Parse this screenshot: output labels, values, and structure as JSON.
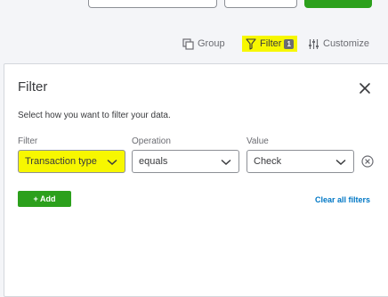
{
  "toolbar": {
    "group_label": "Group",
    "filter_label": "Filter",
    "filter_count": "1",
    "customize_label": "Customize"
  },
  "panel": {
    "title": "Filter",
    "description": "Select how you want to filter your data.",
    "filter_label": "Filter",
    "operation_label": "Operation",
    "value_label": "Value",
    "filter_value": "Transaction type",
    "operation_value": "equals",
    "value_value": "Check",
    "add_label": "+ Add",
    "clear_label": "Clear all filters"
  },
  "colors": {
    "highlight": "#f7f700",
    "primary_green": "#2ca01c",
    "link_blue": "#0077c5"
  }
}
